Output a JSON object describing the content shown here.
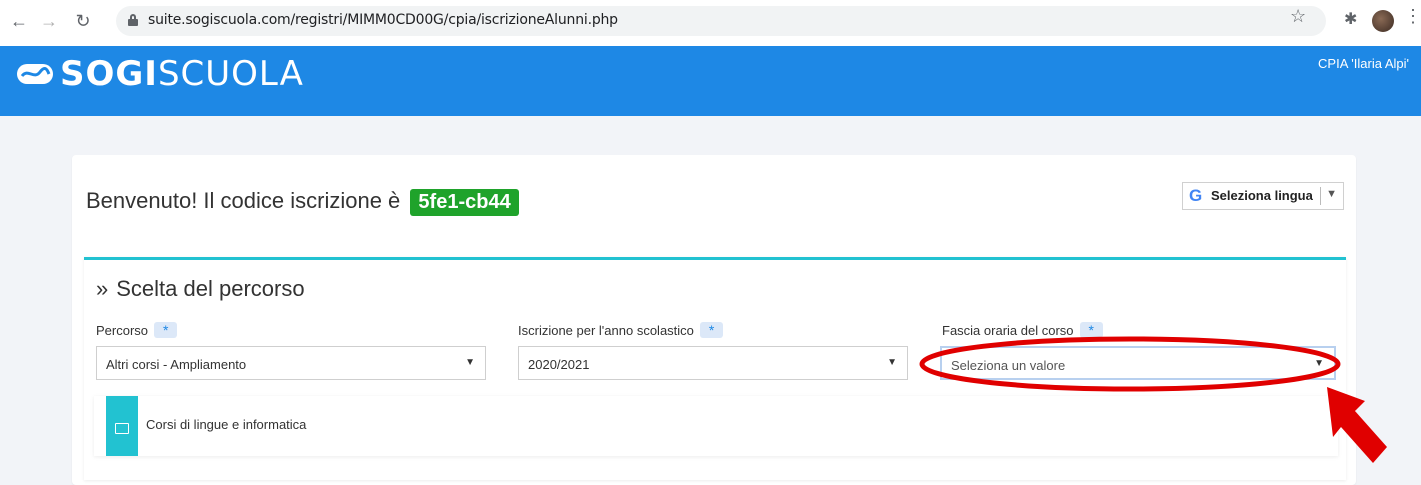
{
  "browser": {
    "url": "suite.sogiscuola.com/registri/MIMM0CD00G/cpia/iscrizioneAlunni.php"
  },
  "header": {
    "logo_bold": "SOGI",
    "logo_light": "SCUOLA",
    "school": "CPIA 'Ilaria Alpi'",
    "brand_color": "#1e88e5"
  },
  "welcome": {
    "text": "Benvenuto! Il codice iscrizione è",
    "code": "5fe1-cb44"
  },
  "language": {
    "label": "Seleziona lingua"
  },
  "section": {
    "title": "Scelta del percorso",
    "fields": [
      {
        "label": "Percorso",
        "value": "Altri corsi - Ampliamento"
      },
      {
        "label": "Iscrizione per l'anno scolastico",
        "value": "2020/2021"
      },
      {
        "label": "Fascia oraria del corso",
        "value": "Seleziona un valore"
      }
    ],
    "required_mark": "*",
    "course_item": "Corsi di lingue e informatica"
  },
  "colors": {
    "accent_teal": "#22c2d1",
    "code_green": "#1fa32b",
    "annotation_red": "#e00000"
  }
}
